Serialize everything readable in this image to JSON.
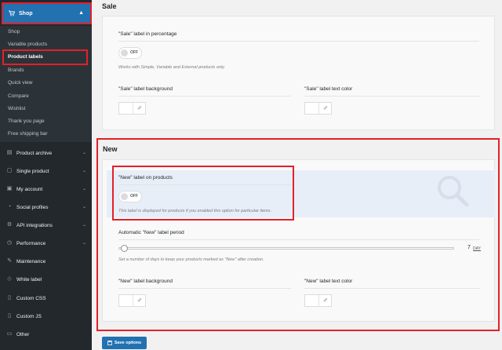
{
  "sidebar": {
    "shop_label": "Shop",
    "sub_items": [
      "Shop",
      "Variable products",
      "Product labels",
      "Brands",
      "Quick view",
      "Compare",
      "Wishlist",
      "Thank you page",
      "Free shipping bar"
    ],
    "menu_items": [
      {
        "label": "Product archive",
        "icon": "archive-icon"
      },
      {
        "label": "Single product",
        "icon": "lock-icon"
      },
      {
        "label": "My account",
        "icon": "account-icon"
      },
      {
        "label": "Social profiles",
        "icon": "social-icon"
      },
      {
        "label": "API integrations",
        "icon": "api-icon"
      },
      {
        "label": "Performance",
        "icon": "performance-icon"
      },
      {
        "label": "Maintenance",
        "icon": "wrench-icon"
      },
      {
        "label": "White label",
        "icon": "tag-icon"
      },
      {
        "label": "Custom CSS",
        "icon": "css-icon"
      },
      {
        "label": "Custom JS",
        "icon": "js-icon"
      },
      {
        "label": "Other",
        "icon": "other-icon"
      }
    ]
  },
  "sale": {
    "title": "Sale",
    "percentage_label": "\"Sale\" label in percentage",
    "percentage_toggle": "OFF",
    "percentage_desc": "Works with Simple, Variable and External products only.",
    "background_label": "\"Sale\" label background",
    "text_color_label": "\"Sale\" label text color"
  },
  "new": {
    "title": "New",
    "on_products_label": "\"New\" label on products",
    "on_products_toggle": "OFF",
    "on_products_desc": "This label is displayed for products if you enabled this option for particular items.",
    "period_label": "Automatic \"New\" label period",
    "period_value": "7",
    "period_unit": "DAY",
    "period_desc": "Set a number of days to keep your products marked as \"New\" after creation.",
    "background_label": "\"New\" label background",
    "text_color_label": "\"New\" label text color"
  },
  "save_button": "Save options"
}
